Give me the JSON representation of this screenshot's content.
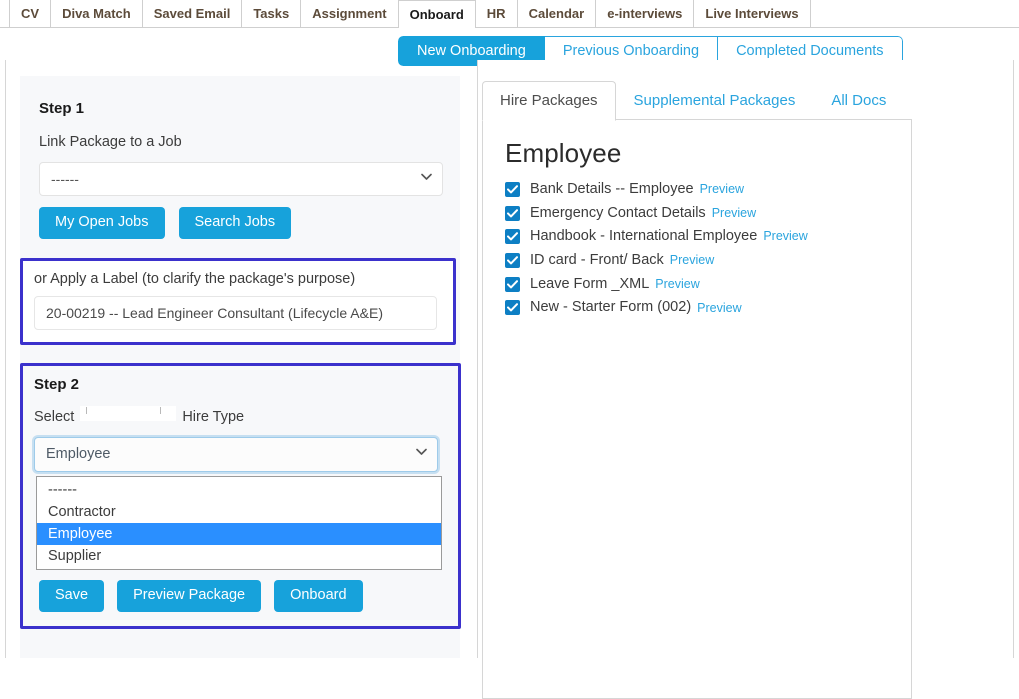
{
  "main_tabs": [
    {
      "label": "CV",
      "active": false
    },
    {
      "label": "Diva Match",
      "active": false
    },
    {
      "label": "Saved Email",
      "active": false
    },
    {
      "label": "Tasks",
      "active": false
    },
    {
      "label": "Assignment",
      "active": false
    },
    {
      "label": "Onboard",
      "active": true
    },
    {
      "label": "HR",
      "active": false
    },
    {
      "label": "Calendar",
      "active": false
    },
    {
      "label": "e-interviews",
      "active": false
    },
    {
      "label": "Live Interviews",
      "active": false
    }
  ],
  "subnav": [
    {
      "label": "New Onboarding",
      "active": true
    },
    {
      "label": "Previous Onboarding",
      "active": false
    },
    {
      "label": "Completed Documents",
      "active": false
    }
  ],
  "step1": {
    "title": "Step 1",
    "label": "Link Package to a Job",
    "job_select_value": "------",
    "my_open_jobs_button": "My Open Jobs",
    "search_jobs_button": "Search Jobs"
  },
  "label_box": {
    "title": "or Apply a Label (to clarify the package's purpose)",
    "input_value": "20-00219 -- Lead Engineer Consultant (Lifecycle A&E)"
  },
  "step2": {
    "title": "Step 2",
    "label_prefix": "Select",
    "label_suffix": "Hire Type",
    "select_value": "Employee",
    "options": [
      {
        "label": "------",
        "selected": false
      },
      {
        "label": "Contractor",
        "selected": false
      },
      {
        "label": "Employee",
        "selected": true
      },
      {
        "label": "Supplier",
        "selected": false
      }
    ],
    "save_button": "Save",
    "preview_package_button": "Preview Package",
    "onboard_button": "Onboard"
  },
  "right_panel": {
    "tabs": [
      {
        "label": "Hire Packages",
        "active": true
      },
      {
        "label": "Supplemental Packages",
        "active": false
      },
      {
        "label": "All Docs",
        "active": false
      }
    ],
    "package_title": "Employee",
    "preview_label": "Preview",
    "documents": [
      {
        "name": "Bank Details -- Employee",
        "checked": true
      },
      {
        "name": "Emergency Contact Details",
        "checked": true
      },
      {
        "name": "Handbook - International Employee",
        "checked": true
      },
      {
        "name": "ID card - Front/ Back",
        "checked": true
      },
      {
        "name": "Leave Form _XML",
        "checked": true
      },
      {
        "name": "New - Starter Form (002)",
        "checked": true
      }
    ]
  },
  "colors": {
    "accent_blue": "#17a2db",
    "link_blue": "#2aa4de",
    "checkbox_blue": "#0d7fc4",
    "highlight_blue": "#2a8fff",
    "outline_purple": "#3b31cc"
  }
}
